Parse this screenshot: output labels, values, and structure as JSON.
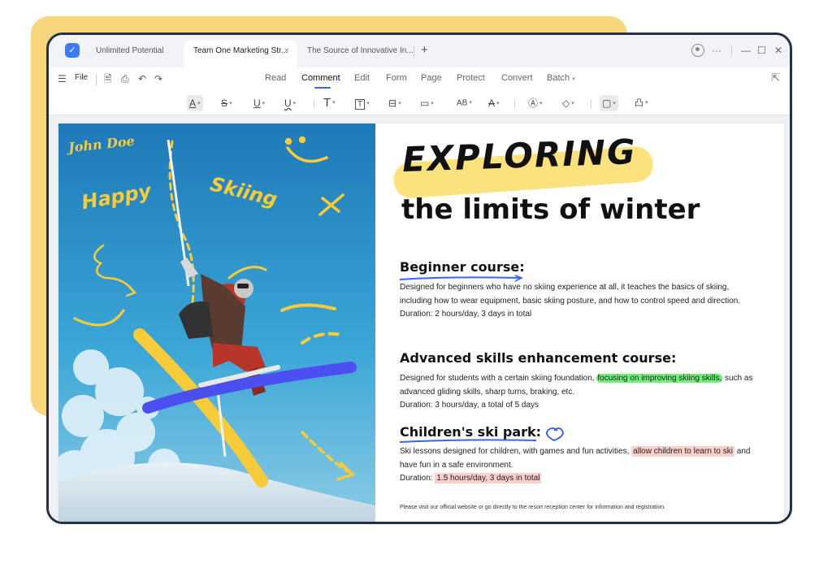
{
  "tabs": [
    {
      "label": "Unlimited Potential",
      "active": false
    },
    {
      "label": "Team One Marketing Str...",
      "active": true,
      "close": "×"
    },
    {
      "label": "The Source of Innovative In...",
      "active": false
    }
  ],
  "tab_add": "+",
  "window_controls": {
    "more": "···",
    "minimize": "—",
    "maximize": "☐",
    "close": "✕"
  },
  "menu": {
    "file_label": "File",
    "tabs": [
      "Read",
      "Comment",
      "Edit",
      "Form",
      "Page",
      "Protect",
      "Convert",
      "Batch"
    ],
    "active_tab": "Comment"
  },
  "toolbar": {
    "tools": [
      {
        "name": "highlight-icon",
        "glyph": "A"
      },
      {
        "name": "strikethrough-icon",
        "glyph": "S"
      },
      {
        "name": "underline-icon",
        "glyph": "U"
      },
      {
        "name": "squiggly-underline-icon",
        "glyph": "U"
      },
      {
        "name": "text-icon",
        "glyph": "T"
      },
      {
        "name": "textbox-icon",
        "glyph": "T"
      },
      {
        "name": "callout-icon",
        "glyph": "⊟"
      },
      {
        "name": "note-icon",
        "glyph": "▭"
      },
      {
        "name": "replace-text-icon",
        "glyph": "AB"
      },
      {
        "name": "insert-text-icon",
        "glyph": "A"
      },
      {
        "name": "pen-icon",
        "glyph": "Ⓐ"
      },
      {
        "name": "eraser-icon",
        "glyph": "◇"
      },
      {
        "name": "shape-icon",
        "glyph": "▢"
      },
      {
        "name": "stamp-icon",
        "glyph": "凸"
      }
    ]
  },
  "photo": {
    "handwriting_name": "John Doe",
    "handwriting_happy": "Happy",
    "handwriting_skiing": "Skiing"
  },
  "document": {
    "title": "EXPLORING",
    "subtitle": "the limits of winter",
    "sections": [
      {
        "heading": "Beginner course:",
        "text": "Designed for beginners who have no skiing experience at all, it teaches the basics of skiing, including how to wear equipment, basic skiing posture, and how to control speed and direction.",
        "duration": "Duration: 2 hours/day, 3 days in total"
      },
      {
        "heading": "Advanced skills enhancement course:",
        "text_before": "Designed for students with a certain skiing foundation,",
        "text_highlight": "focusing on improving skiing skills,",
        "text_after": "such as advanced gliding skills, sharp turns, braking, etc.",
        "duration": "Duration: 3 hours/day, a total of 5 days"
      },
      {
        "heading": "Children's ski park:",
        "text_before": "Ski lessons designed for children, with games and fun activities,",
        "text_highlight": "allow children to learn to ski",
        "text_after": "and have fun in a safe environment.",
        "duration_label": "Duration:",
        "duration_highlight": "1.5 hours/day, 3 days in total"
      }
    ],
    "footnote": "Please visit our official website or go directly to the resort reception center for information and registration."
  },
  "colors": {
    "accent": "#3d62f5",
    "highlight_yellow": "#fbe27c",
    "highlight_green": "#6ff078",
    "highlight_pink": "#fbcfca",
    "frame": "#243044"
  }
}
